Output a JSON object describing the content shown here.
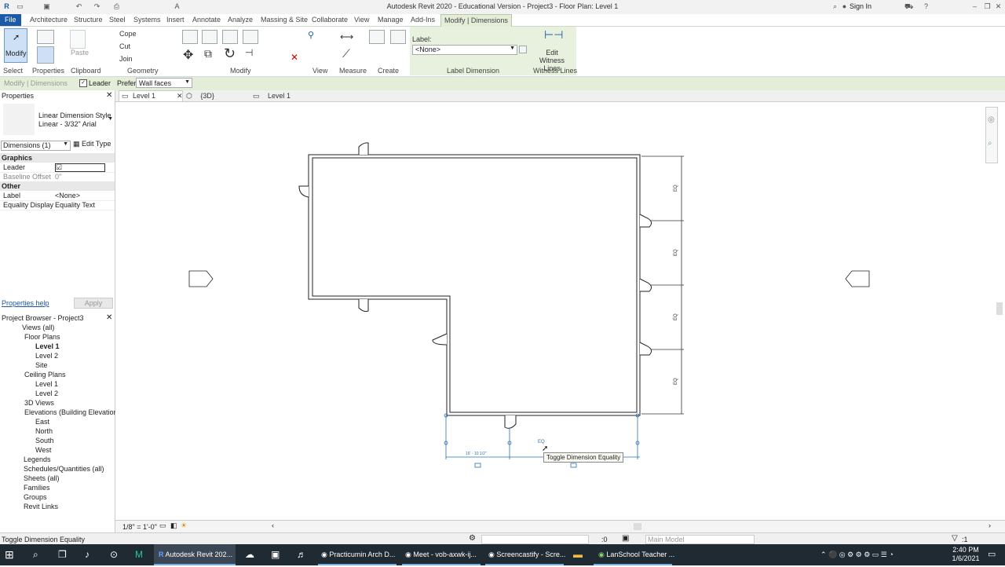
{
  "window": {
    "title": "Autodesk Revit 2020 - Educational Version - Project3 - Floor Plan: Level 1",
    "sign_in": "Sign In"
  },
  "ribbon_tabs": [
    "File",
    "Architecture",
    "Structure",
    "Steel",
    "Systems",
    "Insert",
    "Annotate",
    "Analyze",
    "Massing & Site",
    "Collaborate",
    "View",
    "Manage",
    "Add-Ins",
    "Modify | Dimensions"
  ],
  "ribbon": {
    "modify": "Modify",
    "paste": "Paste",
    "cope": "Cope",
    "cut": "Cut",
    "join": "Join",
    "label_caption": "Label:",
    "label_value": "<None>",
    "edit_witness": "Edit Witness Lines",
    "panels": {
      "select": "Select",
      "properties": "Properties",
      "clipboard": "Clipboard",
      "geometry": "Geometry",
      "modify": "Modify",
      "view": "View",
      "measure": "Measure",
      "create": "Create",
      "label_dimension": "Label Dimension",
      "witness_lines": "Witness Lines"
    }
  },
  "options_bar": {
    "context": "Modify | Dimensions",
    "leader": "Leader",
    "prefer_label": "Prefer:",
    "prefer_value": "Wall faces"
  },
  "properties": {
    "title": "Properties",
    "type_name": "Linear Dimension Style",
    "type_sub": "Linear - 3/32\" Arial",
    "selector": "Dimensions (1)",
    "edit_type": "Edit Type",
    "groups": [
      {
        "name": "Graphics",
        "rows": [
          {
            "k": "Leader",
            "v": "☑"
          },
          {
            "k": "Baseline Offset",
            "v": "0\""
          }
        ]
      },
      {
        "name": "Other",
        "rows": [
          {
            "k": "Label",
            "v": "<None>"
          },
          {
            "k": "Equality Display",
            "v": "Equality Text"
          }
        ]
      }
    ],
    "help": "Properties help",
    "apply": "Apply"
  },
  "browser": {
    "title": "Project Browser - Project3",
    "nodes": [
      {
        "t": "Views (all)",
        "d": 0
      },
      {
        "t": "Floor Plans",
        "d": 1
      },
      {
        "t": "Level 1",
        "d": 2,
        "bold": true
      },
      {
        "t": "Level 2",
        "d": 2
      },
      {
        "t": "Site",
        "d": 2
      },
      {
        "t": "Ceiling Plans",
        "d": 1
      },
      {
        "t": "Level 1",
        "d": 2
      },
      {
        "t": "Level 2",
        "d": 2
      },
      {
        "t": "3D Views",
        "d": 1
      },
      {
        "t": "Elevations (Building Elevation)",
        "d": 1
      },
      {
        "t": "East",
        "d": 2
      },
      {
        "t": "North",
        "d": 2
      },
      {
        "t": "South",
        "d": 2
      },
      {
        "t": "West",
        "d": 2
      },
      {
        "t": "Legends",
        "d": 0
      },
      {
        "t": "Schedules/Quantities (all)",
        "d": 0
      },
      {
        "t": "Sheets (all)",
        "d": 0
      },
      {
        "t": "Families",
        "d": 0
      },
      {
        "t": "Groups",
        "d": 0
      },
      {
        "t": "Revit Links",
        "d": 0
      }
    ]
  },
  "view_tabs": [
    "Level 1",
    "{3D}",
    "Level 1"
  ],
  "canvas": {
    "dim_text": "16' - 10 1/2\"",
    "eq_marker": "EQ",
    "tooltip": "Toggle Dimension Equality"
  },
  "view_control": {
    "scale": "1/8\" = 1'-0\""
  },
  "status": {
    "text": "Toggle Dimension Equality",
    "workset": ":0",
    "model": "Main Model"
  },
  "taskbar": {
    "items": [
      "Autodesk Revit 202...",
      "Practicumin Arch D...",
      "Meet - vob-axwk-ij...",
      "Screencastify - Scre...",
      "LanSchool Teacher ..."
    ],
    "time": "2:40 PM",
    "date": "1/6/2021"
  }
}
